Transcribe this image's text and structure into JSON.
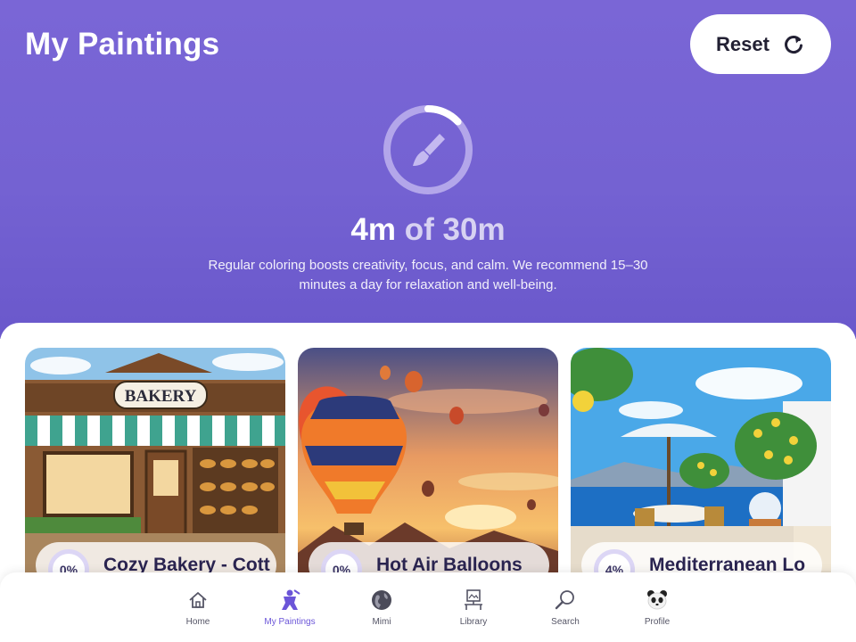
{
  "header": {
    "title": "My Paintings",
    "reset_label": "Reset",
    "progress_fraction": 0.13,
    "time_spent": "4m",
    "time_of": "of 30m",
    "description": "Regular coloring boosts creativity, focus, and calm. We recommend 15–30 minutes a day for relaxation and well-being."
  },
  "paintings": [
    {
      "percent": "0%",
      "title": "Cozy Bakery - Cott",
      "sign": "BAKERY"
    },
    {
      "percent": "0%",
      "title": "Hot Air Balloons"
    },
    {
      "percent": "4%",
      "title": "Mediterranean Lo"
    }
  ],
  "tabs": [
    {
      "label": "Home",
      "icon": "house-icon"
    },
    {
      "label": "My Paintings",
      "icon": "paint-figure-icon"
    },
    {
      "label": "Mimi",
      "icon": "globe-icon"
    },
    {
      "label": "Library",
      "icon": "gallery-icon"
    },
    {
      "label": "Search",
      "icon": "magnifier-icon"
    },
    {
      "label": "Profile",
      "icon": "panda-icon"
    }
  ],
  "colors": {
    "header_bg": "#7462d2",
    "accent": "#6b55d8",
    "ring_track": "#b3a6ea",
    "text_dark": "#222033"
  }
}
